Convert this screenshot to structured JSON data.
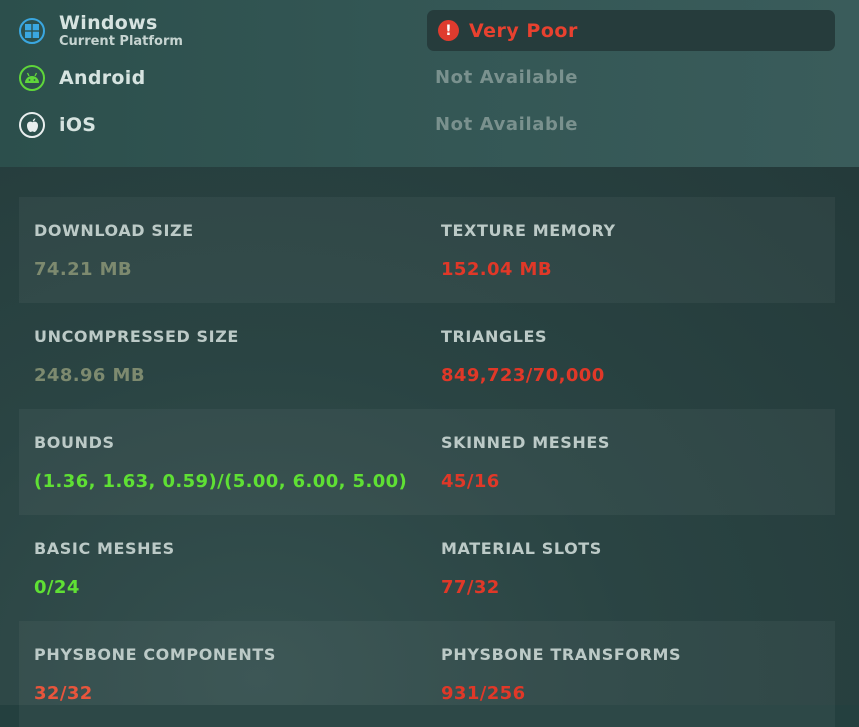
{
  "platforms": [
    {
      "name": "Windows",
      "subtitle": "Current Platform",
      "icon": "windows-icon",
      "color": "#3aa7e0"
    },
    {
      "name": "Android",
      "subtitle": "",
      "icon": "android-icon",
      "color": "#5fd63a"
    },
    {
      "name": "iOS",
      "subtitle": "",
      "icon": "apple-icon",
      "color": "#e8eeee"
    }
  ],
  "rating": {
    "icon": "alert-icon",
    "label": "Very Poor",
    "color": "#e8412f"
  },
  "availability": {
    "android": "Not Available",
    "ios": "Not Available"
  },
  "stats": [
    {
      "left": {
        "label": "DOWNLOAD SIZE",
        "value": "74.21 MB"
      },
      "right": {
        "label": "TEXTURE MEMORY",
        "value": "152.04 MB"
      }
    },
    {
      "left": {
        "label": "UNCOMPRESSED SIZE",
        "value": "248.96 MB"
      },
      "right": {
        "label": "TRIANGLES",
        "value": "849,723/70,000"
      }
    },
    {
      "left": {
        "label": "BOUNDS",
        "value": "(1.36, 1.63, 0.59)/(5.00, 6.00, 5.00)"
      },
      "right": {
        "label": "SKINNED MESHES",
        "value": "45/16"
      }
    },
    {
      "left": {
        "label": "BASIC MESHES",
        "value": "0/24"
      },
      "right": {
        "label": "MATERIAL SLOTS",
        "value": "77/32"
      }
    },
    {
      "left": {
        "label": "PHYSBONE COMPONENTS",
        "value": "32/32"
      },
      "right": {
        "label": "PHYSBONE TRANSFORMS",
        "value": "931/256"
      }
    }
  ]
}
